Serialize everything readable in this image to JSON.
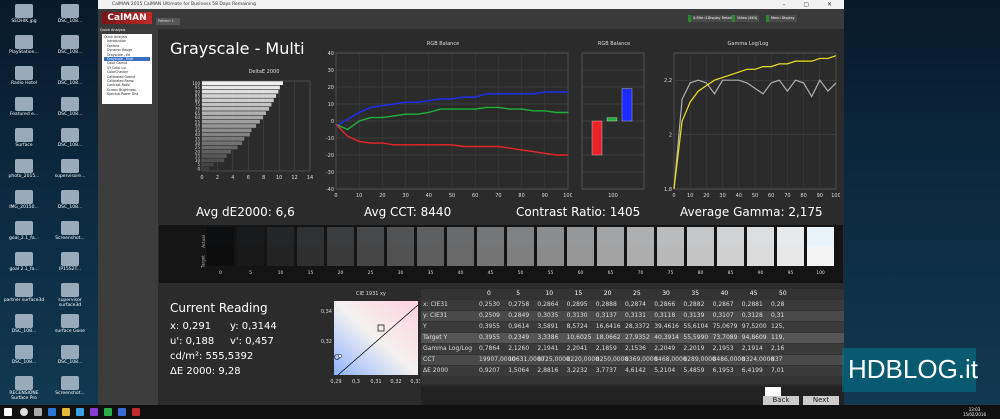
{
  "desktop": {
    "icons": [
      "SEDHIK.jpg",
      "DSC_108...",
      "PlayStation...",
      "DSC_108...",
      "Radio Hotel",
      "DSC_108...",
      "Featured e...",
      "DSC_108...",
      "Surface",
      "DSC_108...",
      "photo_2015...",
      "supervisore...",
      "IMG_20150...",
      "DSC_108...",
      "goal_2.1_fa...",
      "Screenshot...",
      "goal 2.1_fa...",
      "IP15S2T...",
      "partner surface3d",
      "supervisor surface3d",
      "DSC_108...",
      "surface Gone",
      "DSC_108...",
      "DSC_108...",
      "RECENSIONE Surface Pro",
      "Screenshot..."
    ]
  },
  "window": {
    "title": "CalMAN 2015 CalMAN Ultimate for Business 58 Days Remaining",
    "logo": "CalMAN",
    "tab": "Pattern 1",
    "header_buttons": [
      "X-Rite i1Display Retail (i1D 1.45)",
      "Video (4K4)",
      "Menu Display"
    ],
    "workflow_label": "Quick Analysis",
    "nav_items": [
      "Quick Analysis",
      "Introduction",
      "Options",
      "Dynamic Range",
      "Grayscale - Ed",
      "Grayscale - Mult",
      "Color Gamut",
      "XY Color Lvl",
      "ColorChecker",
      "Calibrated Gamut",
      "Calibrated Ramp",
      "Contrast Ratio",
      "Screen Brightness",
      "Spectral Power Dist"
    ]
  },
  "page": {
    "title": "Grayscale - Multi",
    "charts": {
      "deltae": "DeltaE 2000",
      "rgb": "RGB Balance",
      "rgbbar": "RGB Balance",
      "gamma": "Gamma Log/Log"
    },
    "metrics": {
      "avg_de": "Avg dE2000: 6,6",
      "avg_cct": "Avg CCT: 8440",
      "contrast": "Contrast Ratio: 1405",
      "avg_gamma": "Average Gamma: 2,175"
    },
    "swatch_labels": {
      "actual": "Actual",
      "target": "Target"
    },
    "swatch_steps": [
      "0",
      "5",
      "10",
      "15",
      "20",
      "25",
      "30",
      "35",
      "40",
      "45",
      "50",
      "55",
      "60",
      "65",
      "70",
      "75",
      "80",
      "85",
      "90",
      "95",
      "100"
    ],
    "current_reading": {
      "title": "Current Reading",
      "x": "x: 0,291",
      "y": "y: 0,3144",
      "u": "u': 0,188",
      "v": "v': 0,457",
      "cdm2": "cd/m²: 555,5392",
      "de": "ΔE 2000: 9,28"
    },
    "cie": {
      "title": "CIE 1931 xy",
      "y_ticks": [
        "0,34",
        "0,32"
      ],
      "x_ticks": [
        "0,29",
        "0,3",
        "0,31",
        "0,32",
        "0,33"
      ]
    },
    "table": {
      "columns": [
        "0",
        "5",
        "10",
        "15",
        "20",
        "25",
        "30",
        "35",
        "40",
        "45",
        "50"
      ],
      "rows": [
        {
          "label": "x: CIE31",
          "values": [
            "0,2530",
            "0,2758",
            "0,2864",
            "0,2895",
            "0,2888",
            "0,2874",
            "0,2866",
            "0,2882",
            "0,2867",
            "0,2881",
            "0,28"
          ]
        },
        {
          "label": "y: CIE31",
          "values": [
            "0,2509",
            "0,2849",
            "0,3035",
            "0,3130",
            "0,3137",
            "0,3131",
            "0,3118",
            "0,3139",
            "0,3107",
            "0,3128",
            "0,31"
          ]
        },
        {
          "label": "Y",
          "values": [
            "0,3955",
            "0,9614",
            "3,5891",
            "8,5724",
            "16,6416",
            "28,3372",
            "39,4616",
            "55,6104",
            "75,0679",
            "97,5200",
            "125,"
          ]
        },
        {
          "label": "Target Y",
          "values": [
            "0,3955",
            "0,2349",
            "3,3386",
            "10,6025",
            "18,0662",
            "27,9352",
            "40,3914",
            "55,5990",
            "73,7089",
            "94,8609",
            "119,"
          ]
        },
        {
          "label": "Gamma Log/Log",
          "values": [
            "0,7864",
            "2,1260",
            "2,1941",
            "2,2041",
            "2,1859",
            "2,1536",
            "2,2049",
            "2,2019",
            "2,1953",
            "2,1914",
            "2,16"
          ]
        },
        {
          "label": "CCT",
          "values": [
            "19907,0000",
            "10631,0000",
            "8725,0000",
            "8220,0000",
            "8250,0000",
            "8369,0000",
            "8468,0000",
            "8289,0000",
            "8486,0000",
            "8324,0000",
            "837"
          ]
        },
        {
          "label": "ΔE 2000",
          "values": [
            "0,9207",
            "1,5064",
            "2,8816",
            "3,2232",
            "3,7737",
            "4,6142",
            "5,2104",
            "5,4859",
            "6,1953",
            "6,4199",
            "7,01"
          ]
        }
      ]
    },
    "footer": {
      "back": "Back",
      "next": "Next"
    }
  },
  "watermark": "HDBLOG.it",
  "taskbar": {
    "time": "13:03",
    "date": "15/02/2016"
  },
  "chart_data": [
    {
      "type": "bar",
      "title": "DeltaE 2000",
      "categories": [
        "0",
        "5",
        "10",
        "15",
        "20",
        "25",
        "30",
        "35",
        "40",
        "45",
        "50",
        "55",
        "60",
        "65",
        "70",
        "75",
        "80",
        "85",
        "90",
        "95",
        "100"
      ],
      "values": [
        0.92,
        1.51,
        2.88,
        3.22,
        3.77,
        4.61,
        5.21,
        5.49,
        6.2,
        6.42,
        7.01,
        7.5,
        7.9,
        8.3,
        8.7,
        9.0,
        9.3,
        9.6,
        9.9,
        10.1,
        10.5
      ],
      "xlim": [
        0,
        14
      ],
      "x_ticks": [
        "0",
        "2",
        "4",
        "6",
        "8",
        "10",
        "12",
        "14"
      ],
      "y_ticks": [
        "0",
        "5",
        "10",
        "15",
        "20",
        "25",
        "30",
        "35",
        "40",
        "45",
        "50",
        "55",
        "60",
        "65",
        "70",
        "75",
        "80",
        "85",
        "90",
        "95",
        "100"
      ],
      "orientation": "horizontal"
    },
    {
      "type": "line",
      "title": "RGB Balance",
      "x": [
        0,
        5,
        10,
        15,
        20,
        25,
        30,
        35,
        40,
        45,
        50,
        55,
        60,
        65,
        70,
        75,
        80,
        85,
        90,
        95,
        100
      ],
      "series": [
        {
          "values": [
            -3,
            1,
            5,
            8,
            9,
            10,
            11,
            11,
            12,
            13,
            13,
            14,
            14,
            16,
            16,
            16,
            16,
            16,
            17,
            17,
            17
          ],
          "color": "#1c2cff"
        },
        {
          "values": [
            -2,
            -5,
            0,
            2,
            2,
            3,
            4,
            4,
            5,
            7,
            7,
            7,
            7,
            8,
            8,
            7,
            7,
            6,
            6,
            5,
            5
          ],
          "color": "#1fb33a"
        },
        {
          "values": [
            -2,
            -9,
            -12,
            -13,
            -13,
            -14,
            -14,
            -14,
            -14,
            -14,
            -14,
            -15,
            -15,
            -15,
            -15,
            -16,
            -17,
            -18,
            -19,
            -20,
            -20
          ],
          "color": "#e8242b"
        }
      ],
      "ylim": [
        -40,
        40
      ],
      "xlim": [
        0,
        100
      ],
      "y_ticks": [
        "40",
        "30",
        "20",
        "10",
        "0",
        "-10",
        "-20",
        "-30",
        "-40"
      ],
      "x_ticks": [
        "0",
        "10",
        "20",
        "30",
        "40",
        "50",
        "60",
        "70",
        "80",
        "90",
        "100"
      ],
      "grid": true
    },
    {
      "type": "bar",
      "title": "RGB Balance",
      "categories": [
        "R",
        "G",
        "B"
      ],
      "values": [
        -20,
        2,
        19
      ],
      "colors": [
        "#e8242b",
        "#1fb33a",
        "#1c2cff"
      ],
      "ylim": [
        -40,
        40
      ],
      "x_ticks": [
        "100"
      ]
    },
    {
      "type": "line",
      "title": "Gamma Log/Log",
      "x": [
        0,
        5,
        10,
        15,
        20,
        25,
        30,
        35,
        40,
        45,
        50,
        55,
        60,
        65,
        70,
        75,
        80,
        85,
        90,
        95,
        100
      ],
      "series": [
        {
          "values": [
            1.8,
            2.13,
            2.19,
            2.2,
            2.19,
            2.15,
            2.2,
            2.2,
            2.2,
            2.19,
            2.17,
            2.15,
            2.19,
            2.2,
            2.16,
            2.2,
            2.19,
            2.14,
            2.2,
            2.16,
            2.19
          ],
          "color": "#b0b0b0"
        },
        {
          "values": [
            1.8,
            2.05,
            2.12,
            2.16,
            2.18,
            2.2,
            2.21,
            2.22,
            2.23,
            2.24,
            2.24,
            2.25,
            2.25,
            2.26,
            2.26,
            2.27,
            2.27,
            2.27,
            2.28,
            2.28,
            2.29
          ],
          "color": "#f0e020"
        }
      ],
      "ylim": [
        1.8,
        2.3
      ],
      "xlim": [
        0,
        100
      ],
      "y_ticks": [
        "1,8",
        "2",
        "2,2"
      ],
      "x_ticks": [
        "0",
        "10",
        "20",
        "30",
        "40",
        "50",
        "60",
        "70",
        "80",
        "90",
        "100"
      ],
      "grid": true
    }
  ]
}
